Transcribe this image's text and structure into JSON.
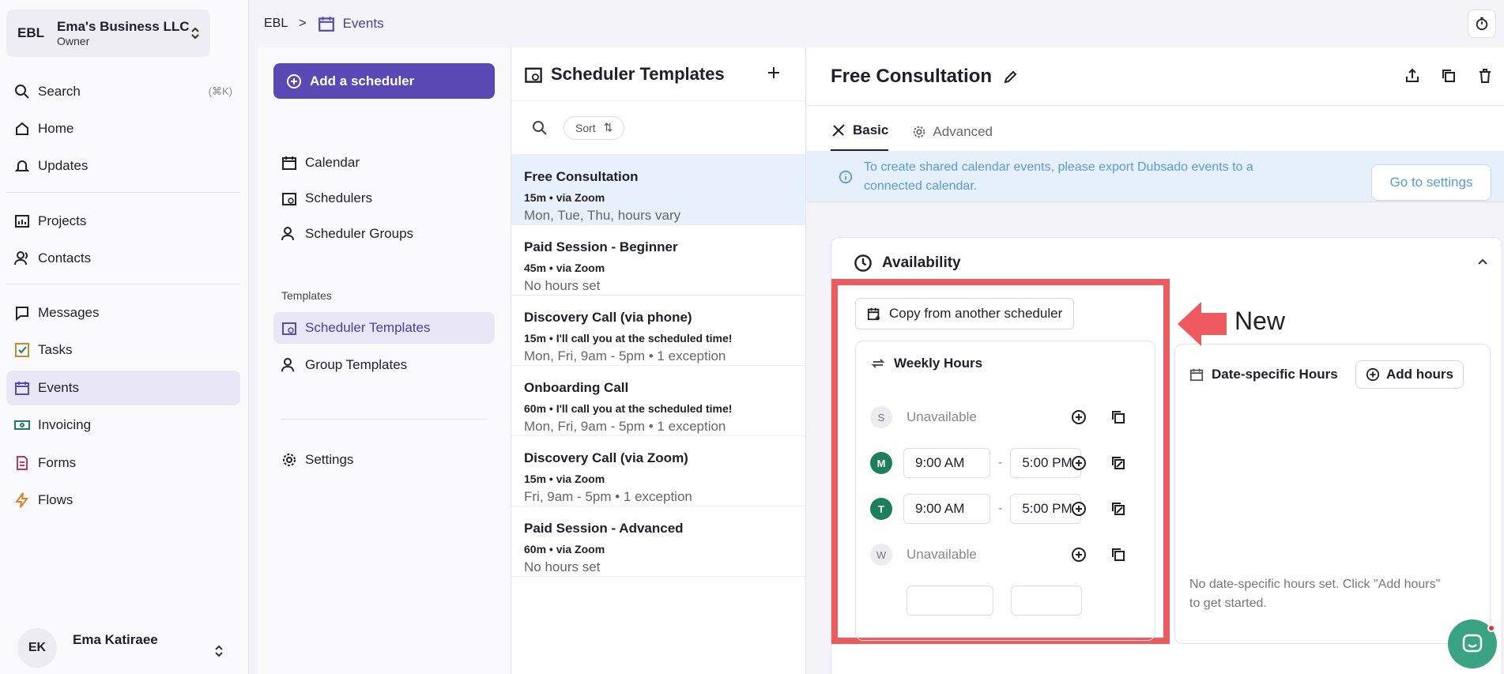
{
  "account": {
    "initials": "EBL",
    "name": "Ema's Business LLC",
    "role": "Owner"
  },
  "nav": {
    "search": {
      "label": "Search",
      "shortcut": "(⌘K)"
    },
    "items_top": [
      {
        "label": "Home"
      },
      {
        "label": "Updates"
      }
    ],
    "items_mid": [
      {
        "label": "Projects"
      },
      {
        "label": "Contacts"
      }
    ],
    "items_bottom": [
      {
        "label": "Messages"
      },
      {
        "label": "Tasks"
      },
      {
        "label": "Events"
      },
      {
        "label": "Invoicing"
      },
      {
        "label": "Forms"
      },
      {
        "label": "Flows"
      }
    ]
  },
  "user": {
    "initials": "EK",
    "name": "Ema Katiraee"
  },
  "breadcrumb": {
    "root": "EBL",
    "separator": ">",
    "current": "Events"
  },
  "schedulers": {
    "add_button": "Add a scheduler",
    "items": [
      {
        "label": "Calendar"
      },
      {
        "label": "Schedulers"
      },
      {
        "label": "Scheduler Groups"
      }
    ],
    "templates_section": "Templates",
    "template_items": [
      {
        "label": "Scheduler Templates"
      },
      {
        "label": "Group Templates"
      }
    ],
    "settings": "Settings"
  },
  "templates": {
    "title": "Scheduler Templates",
    "sort_label": "Sort",
    "rows": [
      {
        "title": "Free Consultation",
        "meta": "15m  •  via Zoom",
        "hours": "Mon, Tue, Thu, hours vary"
      },
      {
        "title": "Paid Session - Beginner",
        "meta": "45m  •  via Zoom",
        "hours": "No hours set"
      },
      {
        "title": "Discovery Call (via phone)",
        "meta": "15m  •  I'll call you at the scheduled time!",
        "hours": "Mon, Fri, 9am - 5pm • 1 exception"
      },
      {
        "title": "Onboarding Call",
        "meta": "60m  •  I'll call you at the scheduled time!",
        "hours": "Mon, Fri, 9am - 5pm • 1 exception"
      },
      {
        "title": "Discovery Call (via Zoom)",
        "meta": "15m  •  via Zoom",
        "hours": "Fri, 9am - 5pm • 1 exception"
      },
      {
        "title": "Paid Session - Advanced",
        "meta": "60m  •  via Zoom",
        "hours": "No hours set"
      }
    ]
  },
  "detail": {
    "title": "Free Consultation",
    "tabs": {
      "basic": "Basic",
      "advanced": "Advanced"
    },
    "banner": {
      "text": "To create shared calendar events, please export Dubsado events to a connected calendar.",
      "button": "Go to settings"
    },
    "availability": {
      "title": "Availability",
      "copy_button": "Copy from another scheduler",
      "weekly_title": "Weekly Hours",
      "days": [
        {
          "letter": "S",
          "available": false,
          "status": "Unavailable"
        },
        {
          "letter": "M",
          "available": true,
          "start": "9:00 AM",
          "end": "5:00 PM"
        },
        {
          "letter": "T",
          "available": true,
          "start": "9:00 AM",
          "end": "5:00 PM"
        },
        {
          "letter": "W",
          "available": false,
          "status": "Unavailable"
        }
      ],
      "date_title": "Date-specific Hours",
      "add_hours": "Add hours",
      "empty_message": "No date-specific hours set. Click \"Add hours\" to get started."
    }
  },
  "annotation": {
    "label": "New",
    "color": "#ef5a5f"
  },
  "colors": {
    "accent": "#5a48b5",
    "active_bg": "#e9e7f6",
    "day_green": "#1b7f5e",
    "info_blue": "#5a9bd4",
    "chat": "#3aa381"
  }
}
